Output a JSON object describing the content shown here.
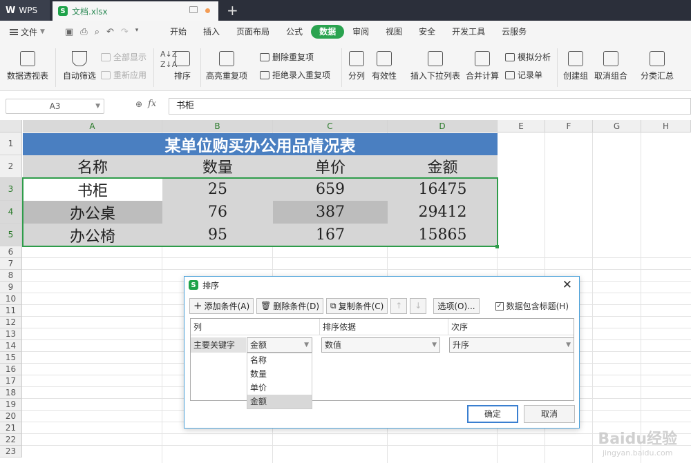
{
  "titlebar": {
    "app_name": "WPS",
    "doc_tab": "文档.xlsx"
  },
  "menubar": {
    "file_label": "文件",
    "tabs": [
      "开始",
      "插入",
      "页面布局",
      "公式",
      "数据",
      "审阅",
      "视图",
      "安全",
      "开发工具",
      "云服务"
    ],
    "active_tab": "数据"
  },
  "ribbon": {
    "pivot": "数据透视表",
    "autofilter": "自动筛选",
    "show_all": "全部显示",
    "reapply": "重新应用",
    "sort": "排序",
    "highlight_dup": "高亮重复项",
    "remove_dup": "删除重复项",
    "reject_dup": "拒绝录入重复项",
    "split": "分列",
    "validity": "有效性",
    "insert_dropdown": "插入下拉列表",
    "consolidate": "合并计算",
    "simulate": "模拟分析",
    "record": "记录单",
    "group": "创建组",
    "ungroup": "取消组合",
    "subtotal": "分类汇总"
  },
  "formula_bar": {
    "name_box": "A3",
    "fx": "fx",
    "value": "书柜"
  },
  "sheet": {
    "columns": [
      "A",
      "B",
      "C",
      "D",
      "E",
      "F",
      "G",
      "H"
    ],
    "rows": [
      "1",
      "2",
      "3",
      "4",
      "5",
      "6",
      "7",
      "8",
      "9",
      "10",
      "11",
      "12",
      "13",
      "14",
      "15",
      "16",
      "17",
      "18",
      "19",
      "20",
      "21",
      "22",
      "23"
    ],
    "title": "某单位购买办公用品情况表",
    "headers": [
      "名称",
      "数量",
      "单价",
      "金额"
    ],
    "data": [
      [
        "书柜",
        "25",
        "659",
        "16475"
      ],
      [
        "办公桌",
        "76",
        "387",
        "29412"
      ],
      [
        "办公椅",
        "95",
        "167",
        "15865"
      ]
    ]
  },
  "sort_dialog": {
    "title": "排序",
    "add_condition": "添加条件(A)",
    "delete_condition": "删除条件(D)",
    "copy_condition": "复制条件(C)",
    "options": "选项(O)...",
    "has_header": "数据包含标题(H)",
    "col_header": "列",
    "basis_header": "排序依据",
    "order_header": "次序",
    "primary_key": "主要关键字",
    "primary_key_value": "金额",
    "basis_value": "数值",
    "order_value": "升序",
    "dropdown_options": [
      "名称",
      "数量",
      "单价",
      "金额"
    ],
    "dropdown_selected": "金额",
    "ok": "确定",
    "cancel": "取消"
  },
  "watermark": {
    "text": "Baidu经验",
    "sub": "jingyan.baidu.com"
  }
}
